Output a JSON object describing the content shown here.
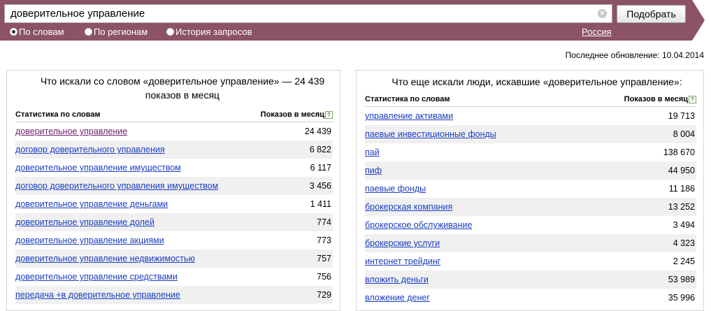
{
  "search": {
    "query": "доверительное управление",
    "submit_label": "Подобрать",
    "clear_glyph": "×"
  },
  "modes": [
    {
      "label": "По словам",
      "selected": true
    },
    {
      "label": "По регионам",
      "selected": false
    },
    {
      "label": "История запросов",
      "selected": false
    }
  ],
  "region": "Россия",
  "last_update": "Последнее обновление: 10.04.2014",
  "left_panel": {
    "title": "Что искали со словом «доверительное управление» — 24 439 показов в месяц",
    "col_words": "Статистика по словам",
    "col_shows": "Показов в месяц",
    "help_glyph": "?",
    "rows": [
      {
        "phrase": "доверительное управление",
        "count": "24 439"
      },
      {
        "phrase": "договор доверительного управления",
        "count": "6 822"
      },
      {
        "phrase": "доверительное управление имуществом",
        "count": "6 117"
      },
      {
        "phrase": "договор доверительного управления имуществом",
        "count": "3 456"
      },
      {
        "phrase": "доверительное управление деньгами",
        "count": "1 411"
      },
      {
        "phrase": "доверительное управление долей",
        "count": "774"
      },
      {
        "phrase": "доверительное управление акциями",
        "count": "773"
      },
      {
        "phrase": "доверительное управление недвижимостью",
        "count": "757"
      },
      {
        "phrase": "доверительное управление средствами",
        "count": "756"
      },
      {
        "phrase": "передача +в доверительное управление",
        "count": "729"
      }
    ]
  },
  "right_panel": {
    "title": "Что еще искали люди, искавшие «доверительное управление»:",
    "col_words": "Статистика по словам",
    "col_shows": "Показов в месяц",
    "help_glyph": "?",
    "rows": [
      {
        "phrase": "управление активами",
        "count": "19 713"
      },
      {
        "phrase": "паевые инвестиционные фонды",
        "count": "8 004"
      },
      {
        "phrase": "пай",
        "count": "138 670"
      },
      {
        "phrase": "пиф",
        "count": "44 950"
      },
      {
        "phrase": "паевые фонды",
        "count": "11 186"
      },
      {
        "phrase": "брокерская компания",
        "count": "13 252"
      },
      {
        "phrase": "брокерское обслуживание",
        "count": "3 494"
      },
      {
        "phrase": "брокерские услуги",
        "count": "4 323"
      },
      {
        "phrase": "интернет трейдинг",
        "count": "2 245"
      },
      {
        "phrase": "вложить деньги",
        "count": "53 989"
      },
      {
        "phrase": "вложение денег",
        "count": "35 996"
      }
    ]
  },
  "colors": {
    "header_band": "#8b5268",
    "link": "#1a3dc1",
    "visited_link": "#6b1f6a"
  }
}
